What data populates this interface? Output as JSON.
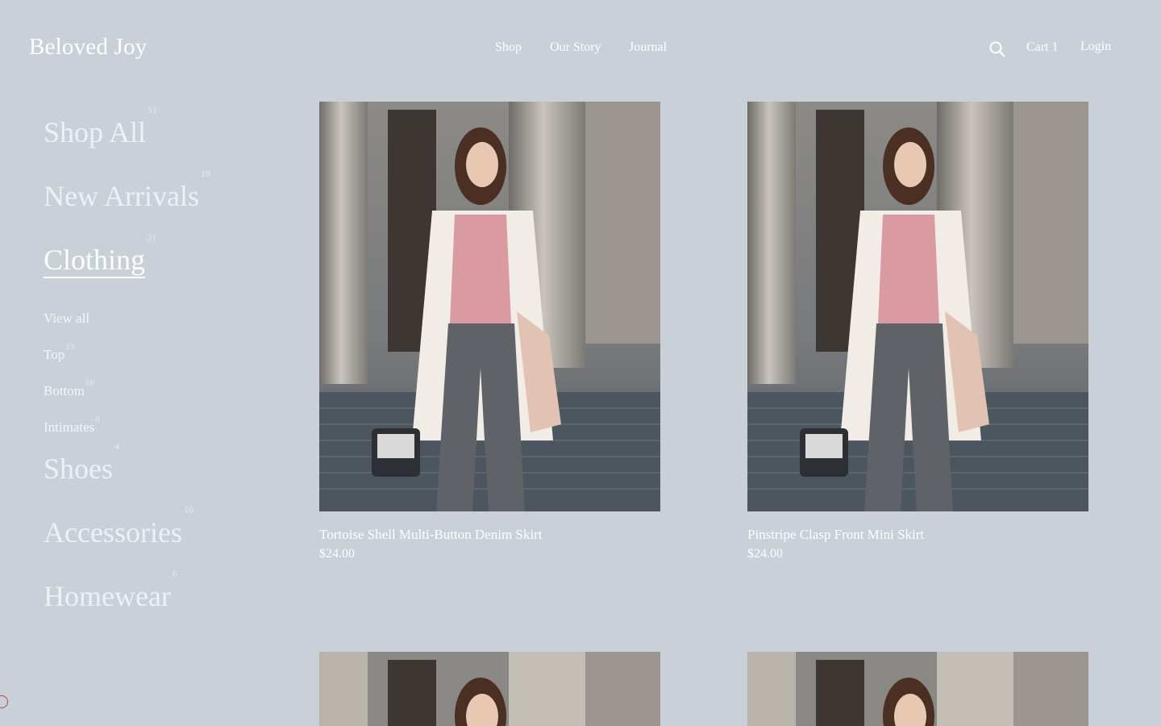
{
  "brand": "Beloved Joy",
  "nav": {
    "shop": "Shop",
    "our_story": "Our Story",
    "journal": "Journal"
  },
  "header": {
    "search_icon": "search-icon",
    "cart_label": "Cart 1",
    "login_label": "Login"
  },
  "sidebar": {
    "categories": [
      {
        "label": "Shop All",
        "count": "51"
      },
      {
        "label": "New Arrivals",
        "count": "19"
      },
      {
        "label": "Clothing",
        "count": "31",
        "active": true
      },
      {
        "label": "Shoes",
        "count": "4"
      },
      {
        "label": "Accessories",
        "count": "10"
      },
      {
        "label": "Homewear",
        "count": "6"
      }
    ],
    "subcategories": [
      {
        "label": "View all",
        "count": ""
      },
      {
        "label": "Top",
        "count": "13"
      },
      {
        "label": "Bottom",
        "count": "10"
      },
      {
        "label": "Intimates",
        "count": "8"
      }
    ]
  },
  "products": [
    {
      "name": "Tortoise Shell Multi-Button Denim Skirt",
      "price": "$24.00"
    },
    {
      "name": "Pinstripe Clasp Front Mini Skirt",
      "price": "$24.00"
    }
  ],
  "colors": {
    "background": "#c9d0d8",
    "text": "#ffffff"
  }
}
